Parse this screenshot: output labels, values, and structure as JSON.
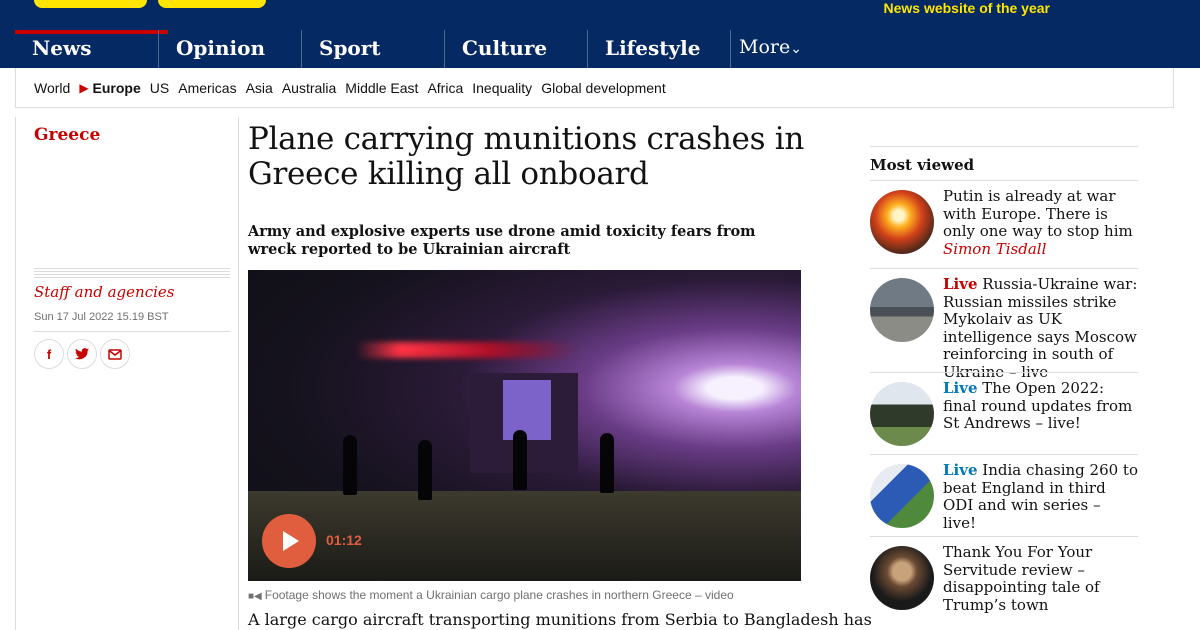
{
  "header": {
    "tagline": "News website of the year"
  },
  "nav": {
    "pillars": [
      "News",
      "Opinion",
      "Sport",
      "Culture",
      "Lifestyle"
    ],
    "more_label": "More"
  },
  "subnav": {
    "items": [
      "World",
      "Europe",
      "US",
      "Americas",
      "Asia",
      "Australia",
      "Middle East",
      "Africa",
      "Inequality",
      "Global development"
    ],
    "active": "Europe"
  },
  "article": {
    "kicker": "Greece",
    "headline": "Plane carrying munitions crashes in Greece killing all onboard",
    "standfirst": "Army and explosive experts use drone amid toxicity fears from wreck reported to be Ukrainian aircraft",
    "byline": "Staff and agencies",
    "date": "Sun 17 Jul 2022 15.19 BST",
    "share_icons": [
      "facebook-icon",
      "twitter-icon",
      "email-icon"
    ],
    "video": {
      "duration": "01:12",
      "caption": "Footage shows the moment a Ukrainian cargo plane crashes in northern Greece – video"
    },
    "body_first_line": "A large cargo aircraft transporting munitions from Serbia to Bangladesh has"
  },
  "most_viewed": {
    "title": "Most viewed",
    "items": [
      {
        "live": "",
        "text": "Putin is already at war with Europe. There is only one way to stop him",
        "author": "Simon Tisdall",
        "live_color": ""
      },
      {
        "live": "Live",
        "text": "Russia-Ukraine war: Russian missiles strike Mykolaiv as UK intelligence says Moscow reinforcing in south of Ukraine – live",
        "author": "",
        "live_color": "#c70000"
      },
      {
        "live": "Live",
        "text": "The Open 2022: final round updates from St Andrews – live!",
        "author": "",
        "live_color": "#0077b6"
      },
      {
        "live": "Live",
        "text": "India chasing 260 to beat England in third ODI and win series – live!",
        "author": "",
        "live_color": "#0077b6"
      },
      {
        "live": "",
        "text": "Thank You For Your Servitude review – disappointing tale of Trump’s town",
        "author": "",
        "live_color": ""
      }
    ]
  },
  "colors": {
    "brand_navy": "#052962",
    "news_red": "#c70000",
    "sport_blue": "#0077b6",
    "highlight_yellow": "#ffe500"
  }
}
